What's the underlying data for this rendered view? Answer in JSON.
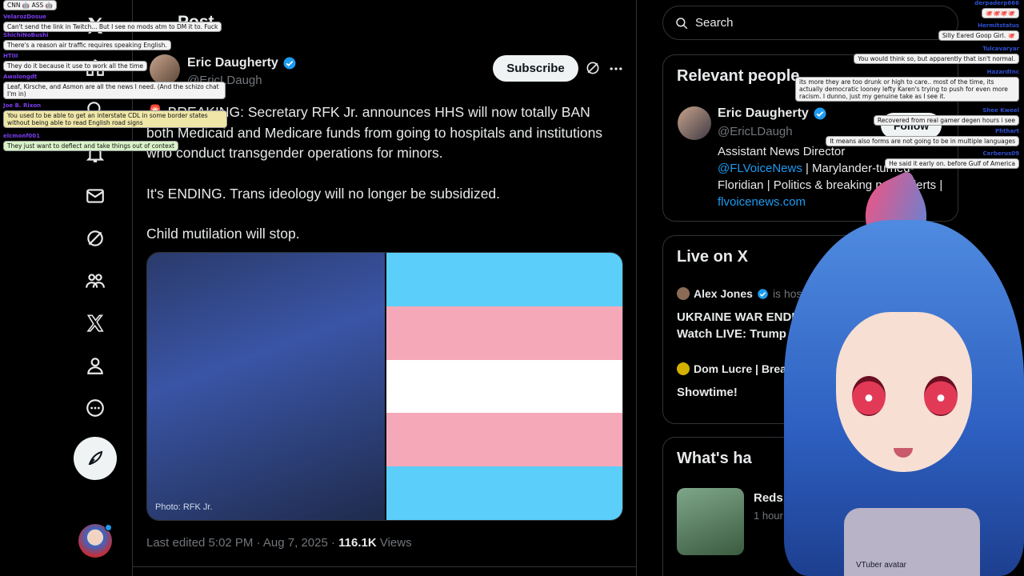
{
  "page": {
    "title": "Post"
  },
  "nav": {
    "icons": [
      "x-logo-icon",
      "home-icon",
      "search-icon",
      "notifications-icon",
      "messages-icon",
      "grok-icon",
      "communities-icon",
      "premium-x-icon",
      "profile-icon",
      "more-icon"
    ],
    "compose_icon": "compose-feather-icon"
  },
  "post": {
    "author_name": "Eric Daugherty",
    "author_handle": "@EricLDaugh",
    "subscribe_label": "Subscribe",
    "paragraphs": [
      "🚨 BREAKING: Secretary RFK Jr. announces HHS will now totally BAN both Medicaid and Medicare funds from going to hospitals and institutions who conduct transgender operations for minors.",
      "It's ENDING. Trans ideology will no longer be subsidized.",
      "Child mutilation will stop."
    ],
    "media_photo_label": "Photo: RFK Jr.",
    "flag_colors": [
      "#5bcefa",
      "#f5a9b8",
      "#ffffff",
      "#f5a9b8",
      "#5bcefa"
    ],
    "meta_prefix": "Last edited 5:02 PM · Aug 7, 2025 · ",
    "views_count": "116.1K",
    "views_label": " Views"
  },
  "search": {
    "placeholder": "Search"
  },
  "relevant_people": {
    "title": "Relevant people",
    "name": "Eric Daugherty",
    "handle": "@EricLDaugh",
    "follow_label": "Follow",
    "bio_line1": "Assistant News Director",
    "bio_link1": "@FLVoiceNews",
    "bio_rest": " | Marylander-turned-Floridian | Politics & breaking news alerts | ",
    "bio_link2": "flvoicenews.com"
  },
  "live": {
    "title": "Live on X",
    "item1_name": "Alex Jones",
    "item1_suffix": "is hos",
    "item1_title_line1": "UKRAINE WAR ENDI",
    "item1_title_line2": "Watch LIVE: Trump",
    "item2_name": "Dom Lucre | Brea",
    "item2_title": "Showtime!"
  },
  "whats_happening": {
    "title": "What's ha",
    "item_title": "Reds at Pirat",
    "item_time": "1 hour ago"
  },
  "overlay": {
    "vtuber_label": "VTuber avatar"
  },
  "chat_left": [
    {
      "user": "",
      "text": "CNN 🤖 ASS 🤖"
    },
    {
      "user": "VelarozDosue",
      "text": "Can't send the link in Twitch... But I see no mods atm to DM it to. Fuck"
    },
    {
      "user": "ShichiNoBushi",
      "text": "There's a reason air traffic requires speaking English."
    },
    {
      "user": "HTIII",
      "text": "They do it because it use to work all the time"
    },
    {
      "user": "Awolongdt",
      "text": "Leaf, Kirsche, and Asmon are all the news I need. (And the schizo chat I'm in)"
    },
    {
      "user": "Joe B. Rixon",
      "text": "You used to be able to get an interstate CDL in some border states without being able to read English road signs"
    },
    {
      "user": "elcmonf001",
      "text": "They just want to deflect and take things out of context"
    }
  ],
  "chat_right": [
    {
      "user": "derpaderp666",
      "text": "🐙🐙🐙🐙"
    },
    {
      "user": "Hermitstatus",
      "text": "Silly Eared Goop Girl. 🐙"
    },
    {
      "user": "Tulcavaryar",
      "text": "You would think so, but apparently that isn't normal."
    },
    {
      "user": "Hazardtnc",
      "text": "its more they are too drunk or high to care.. most of the time, its actually democratic looney lefty Karen's trying to push for even more racism. I dunno, just my genuine take as I see it."
    },
    {
      "user": "Shee Kweel",
      "text": "Recovered from real gamer degen hours i see"
    },
    {
      "user": "Phthart",
      "text": "It means also forms are not going to be in multiple languages"
    },
    {
      "user": "Cerberus09",
      "text": "He said it early on. before Gulf of America"
    }
  ],
  "colors": {
    "accent": "#1d9bf0",
    "background": "#000000",
    "text": "#e7e9ea",
    "muted": "#71767b"
  }
}
